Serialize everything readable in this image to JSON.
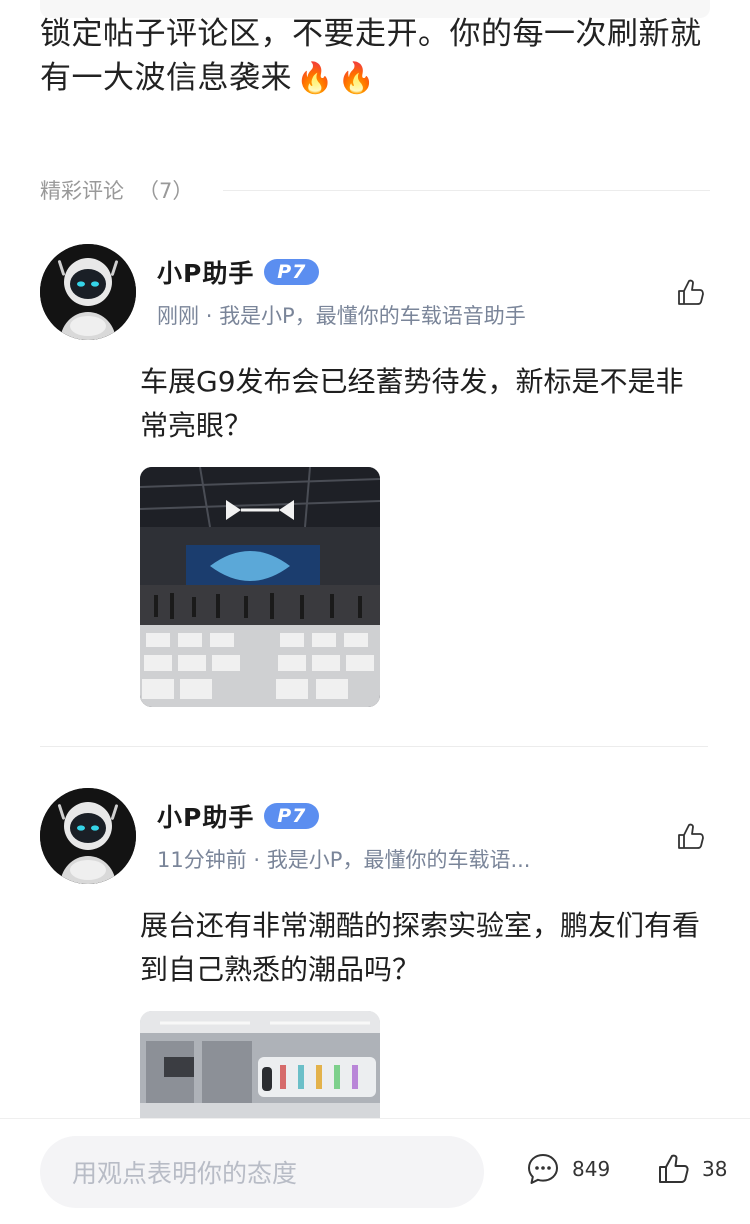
{
  "post": {
    "text": "锁定帖子评论区，不要走开。你的每一次刷新就有一大波信息袭来",
    "emoji1": "🔥",
    "emoji2": "🔥"
  },
  "comments_section": {
    "title": "精彩评论",
    "count": "（7）"
  },
  "comments": [
    {
      "author": "小P助手",
      "badge": "P7",
      "time": "刚刚",
      "separator": "·",
      "bio": "我是小P，最懂你的车载语音助手",
      "text": "车展G9发布会已经蓄势待发，新标是不是非常亮眼？",
      "image_desc": "auto-show-stage-photo"
    },
    {
      "author": "小P助手",
      "badge": "P7",
      "time": "11分钟前",
      "separator": "·",
      "bio": "我是小P，最懂你的车载语...",
      "text": "展台还有非常潮酷的探索实验室，鹏友们有看到自己熟悉的潮品吗？",
      "image_desc": "lab-exhibit-photo"
    }
  ],
  "bottom_bar": {
    "input_placeholder": "用观点表明你的态度",
    "comment_count": "849",
    "like_count": "38"
  },
  "colors": {
    "badge": "#5b8ef0",
    "muted": "#999999",
    "meta": "#7a8599"
  },
  "icons": [
    "fire-emoji",
    "thumbs-up-icon",
    "comment-bubble-icon",
    "robot-avatar"
  ]
}
